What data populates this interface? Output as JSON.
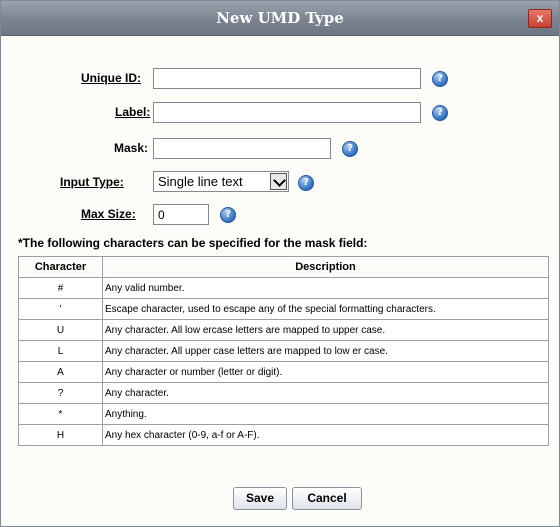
{
  "dialog": {
    "title": "New UMD Type",
    "close_label": "x"
  },
  "form": {
    "unique_id": {
      "label": "Unique ID:",
      "value": ""
    },
    "label": {
      "label": "Label:",
      "value": ""
    },
    "mask": {
      "label": "Mask:",
      "value": ""
    },
    "input_type": {
      "label": "Input Type:",
      "value": "Single line text"
    },
    "max_size": {
      "label": "Max Size:",
      "value": "0"
    },
    "help_glyph": "?"
  },
  "mask_help": {
    "note": "*The following characters can be specified for the mask field:",
    "headers": [
      "Character",
      "Description"
    ],
    "rows": [
      {
        "character": "#",
        "description": "Any valid number."
      },
      {
        "character": "'",
        "description": "Escape character, used to escape any of the special formatting characters."
      },
      {
        "character": "U",
        "description": "Any character. All low ercase letters are mapped to upper case."
      },
      {
        "character": "L",
        "description": "Any character. All upper case letters are mapped to low er case."
      },
      {
        "character": "A",
        "description": "Any character or number (letter or digit)."
      },
      {
        "character": "?",
        "description": "Any character."
      },
      {
        "character": "*",
        "description": "Anything."
      },
      {
        "character": "H",
        "description": "Any hex character (0-9, a-f or A-F)."
      }
    ]
  },
  "buttons": {
    "save": "Save",
    "cancel": "Cancel"
  },
  "colors": {
    "titlebar": "#7b8490",
    "close_button": "#c8402f",
    "help_icon": "#2f6fc0",
    "dialog_background": "#fbfbf7"
  }
}
